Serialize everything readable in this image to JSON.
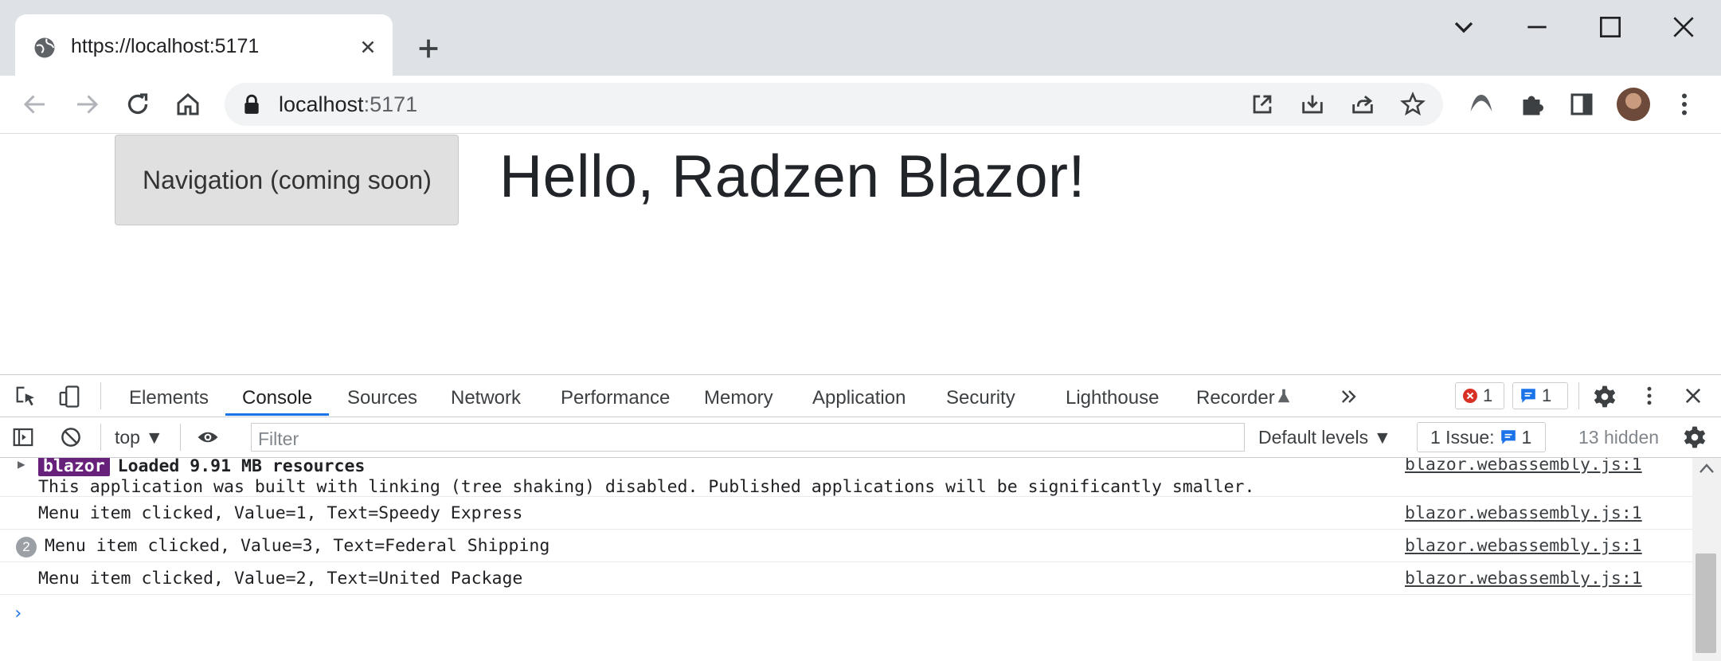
{
  "tab": {
    "title": "https://localhost:5171"
  },
  "omnibox": {
    "url_host": "localhost",
    "url_port": ":5171"
  },
  "page": {
    "nav_label": "Navigation (coming soon)",
    "heading": "Hello, Radzen Blazor!"
  },
  "devtools": {
    "tabs": [
      "Elements",
      "Console",
      "Sources",
      "Network",
      "Performance",
      "Memory",
      "Application",
      "Security",
      "Lighthouse",
      "Recorder"
    ],
    "active_tab": "Console",
    "error_count": "1",
    "message_count": "1",
    "context": "top",
    "filter_placeholder": "Filter",
    "levels": "Default levels",
    "issues_label": "1 Issue:",
    "issues_count": "1",
    "hidden": "13 hidden"
  },
  "console": {
    "messages": [
      {
        "badge": "blazor",
        "text": "Loaded 9.91 MB resources",
        "line2": "This application was built with linking (tree shaking) disabled. Published applications will be significantly smaller.",
        "source": "blazor.webassembly.js:1"
      },
      {
        "text": "Menu item clicked, Value=1, Text=Speedy Express",
        "source": "blazor.webassembly.js:1"
      },
      {
        "count": "2",
        "text": "Menu item clicked, Value=3, Text=Federal Shipping",
        "source": "blazor.webassembly.js:1"
      },
      {
        "text": "Menu item clicked, Value=2, Text=United Package",
        "source": "blazor.webassembly.js:1"
      }
    ],
    "prompt": "›"
  },
  "colors": {
    "accent": "#1a73e8",
    "blazor_badge": "#68217a",
    "chrome_frame": "#dee1e6"
  }
}
